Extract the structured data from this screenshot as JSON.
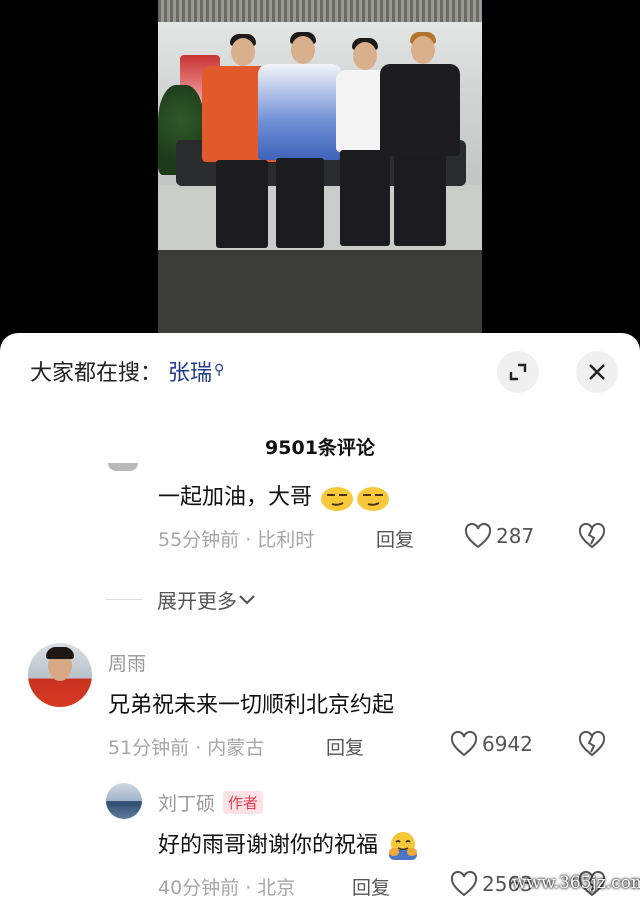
{
  "search": {
    "label": "大家都在搜：",
    "term": "张瑞"
  },
  "comment_count": "9501条评论",
  "comments": [
    {
      "text": "一起加油，大哥",
      "time": "55分钟前",
      "location": "比利时",
      "reply": "回复",
      "likes": "287"
    },
    {
      "name": "周雨",
      "text": "兄弟祝未来一切顺利北京约起",
      "time": "51分钟前",
      "location": "内蒙古",
      "reply": "回复",
      "likes": "6942"
    },
    {
      "name": "刘丁硕",
      "badge": "作者",
      "text": "好的雨哥谢谢你的祝福",
      "time": "40分钟前",
      "location": "北京",
      "reply": "回复",
      "likes": "2563"
    }
  ],
  "expand_more": "展开更多",
  "separator": "·",
  "watermark": "www.365jz.com",
  "icons": [
    "search-icon",
    "expand-icon",
    "close-icon",
    "heart-icon",
    "broken-heart-icon",
    "chevron-down-icon"
  ],
  "colors": {
    "accent": "#1f3b8a",
    "badge_bg": "#fde3e6",
    "badge_text": "#e23b52"
  }
}
